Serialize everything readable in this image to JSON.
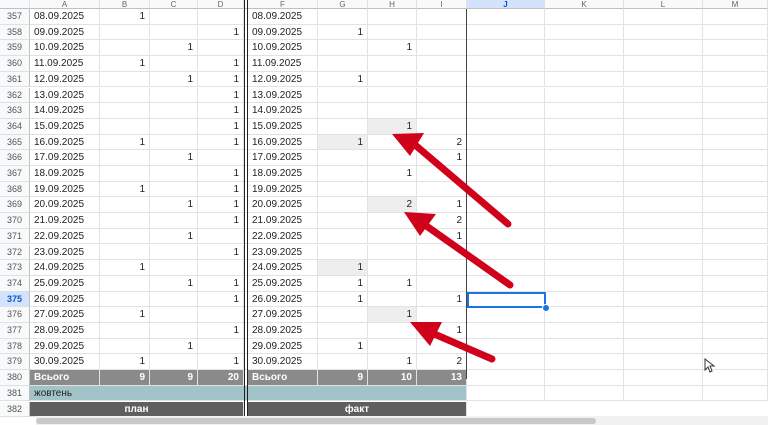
{
  "columns": [
    "A",
    "B",
    "C",
    "D",
    "",
    "F",
    "G",
    "H",
    "I",
    "J",
    "K",
    "L",
    "M"
  ],
  "selected_column": "J",
  "selected_row": "375",
  "rows": [
    {
      "num": "357",
      "a": "08.09.2025",
      "b": "1",
      "c": "",
      "d": "",
      "f": "08.09.2025",
      "g": "",
      "h": "",
      "i": ""
    },
    {
      "num": "358",
      "a": "09.09.2025",
      "b": "",
      "c": "",
      "d": "1",
      "f": "09.09.2025",
      "g": "1",
      "h": "",
      "i": ""
    },
    {
      "num": "359",
      "a": "10.09.2025",
      "b": "",
      "c": "1",
      "d": "",
      "f": "10.09.2025",
      "g": "",
      "h": "1",
      "i": ""
    },
    {
      "num": "360",
      "a": "11.09.2025",
      "b": "1",
      "c": "",
      "d": "1",
      "f": "11.09.2025",
      "g": "",
      "h": "",
      "i": ""
    },
    {
      "num": "361",
      "a": "12.09.2025",
      "b": "",
      "c": "1",
      "d": "1",
      "f": "12.09.2025",
      "g": "1",
      "h": "",
      "i": ""
    },
    {
      "num": "362",
      "a": "13.09.2025",
      "b": "",
      "c": "",
      "d": "1",
      "f": "13.09.2025",
      "g": "",
      "h": "",
      "i": ""
    },
    {
      "num": "363",
      "a": "14.09.2025",
      "b": "",
      "c": "",
      "d": "1",
      "f": "14.09.2025",
      "g": "",
      "h": "",
      "i": ""
    },
    {
      "num": "364",
      "a": "15.09.2025",
      "b": "",
      "c": "",
      "d": "1",
      "f": "15.09.2025",
      "g": "",
      "h": "1",
      "i": ""
    },
    {
      "num": "365",
      "a": "16.09.2025",
      "b": "1",
      "c": "",
      "d": "1",
      "f": "16.09.2025",
      "g": "1",
      "h": "",
      "i": "2"
    },
    {
      "num": "366",
      "a": "17.09.2025",
      "b": "",
      "c": "1",
      "d": "",
      "f": "17.09.2025",
      "g": "",
      "h": "",
      "i": "1"
    },
    {
      "num": "367",
      "a": "18.09.2025",
      "b": "",
      "c": "",
      "d": "1",
      "f": "18.09.2025",
      "g": "",
      "h": "1",
      "i": ""
    },
    {
      "num": "368",
      "a": "19.09.2025",
      "b": "1",
      "c": "",
      "d": "1",
      "f": "19.09.2025",
      "g": "",
      "h": "",
      "i": ""
    },
    {
      "num": "369",
      "a": "20.09.2025",
      "b": "",
      "c": "1",
      "d": "1",
      "f": "20.09.2025",
      "g": "",
      "h": "2",
      "i": "1"
    },
    {
      "num": "370",
      "a": "21.09.2025",
      "b": "",
      "c": "",
      "d": "1",
      "f": "21.09.2025",
      "g": "",
      "h": "",
      "i": "2"
    },
    {
      "num": "371",
      "a": "22.09.2025",
      "b": "",
      "c": "1",
      "d": "",
      "f": "22.09.2025",
      "g": "",
      "h": "",
      "i": "1"
    },
    {
      "num": "372",
      "a": "23.09.2025",
      "b": "",
      "c": "",
      "d": "1",
      "f": "23.09.2025",
      "g": "",
      "h": "",
      "i": ""
    },
    {
      "num": "373",
      "a": "24.09.2025",
      "b": "1",
      "c": "",
      "d": "",
      "f": "24.09.2025",
      "g": "1",
      "h": "",
      "i": ""
    },
    {
      "num": "374",
      "a": "25.09.2025",
      "b": "",
      "c": "1",
      "d": "1",
      "f": "25.09.2025",
      "g": "1",
      "h": "1",
      "i": ""
    },
    {
      "num": "375",
      "a": "26.09.2025",
      "b": "",
      "c": "",
      "d": "1",
      "f": "26.09.2025",
      "g": "1",
      "h": "",
      "i": "1"
    },
    {
      "num": "376",
      "a": "27.09.2025",
      "b": "1",
      "c": "",
      "d": "",
      "f": "27.09.2025",
      "g": "",
      "h": "1",
      "i": ""
    },
    {
      "num": "377",
      "a": "28.09.2025",
      "b": "",
      "c": "",
      "d": "1",
      "f": "28.09.2025",
      "g": "",
      "h": "",
      "i": "1"
    },
    {
      "num": "378",
      "a": "29.09.2025",
      "b": "",
      "c": "1",
      "d": "",
      "f": "29.09.2025",
      "g": "1",
      "h": "",
      "i": ""
    },
    {
      "num": "379",
      "a": "30.09.2025",
      "b": "1",
      "c": "",
      "d": "1",
      "f": "30.09.2025",
      "g": "",
      "h": "1",
      "i": "2"
    }
  ],
  "highlighted_cells": [
    {
      "row": "364",
      "col": "h"
    },
    {
      "row": "365",
      "col": "g"
    },
    {
      "row": "369",
      "col": "h"
    },
    {
      "row": "373",
      "col": "g"
    },
    {
      "row": "376",
      "col": "h"
    }
  ],
  "totals": {
    "num": "380",
    "label_left": "Всього",
    "b": "9",
    "c": "9",
    "d": "20",
    "label_right": "Всього",
    "g": "9",
    "h": "10",
    "i": "13"
  },
  "month_row": {
    "num": "381",
    "label": "жовтень"
  },
  "header_row": {
    "num": "382",
    "left": "план",
    "right": "факт"
  },
  "colors": {
    "arrow": "#d0021b",
    "selection": "#1a73e8",
    "total_bg": "#8a8a8a",
    "teal_bg": "#a2c4c9",
    "dark_bg": "#5f5f5f"
  }
}
